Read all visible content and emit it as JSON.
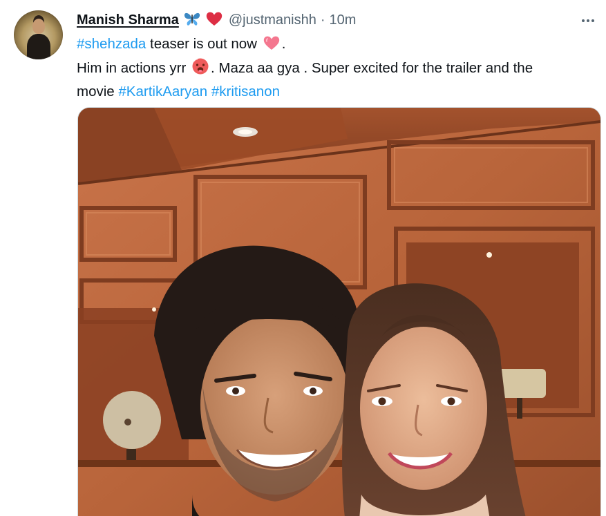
{
  "tweet": {
    "author": {
      "name": "Manish Sharma",
      "badges": [
        "butterfly-emoji",
        "red-heart-emoji"
      ],
      "handle": "@justmanishh",
      "separator": "·",
      "time": "10m"
    },
    "text": {
      "line1": {
        "hashtag": "#shehzada",
        "text": " teaser is out now ",
        "emoji": "pink-heart-emoji",
        "end": "."
      },
      "line2": {
        "text": "Him in actions yrr ",
        "emoji": "hot-face-emoji",
        "rest": ". Maza aa gya . Super excited for the trailer and the"
      },
      "line3": {
        "text": "movie ",
        "hashtag1": "#KartikAaryan",
        "space": " ",
        "hashtag2": "#kritisanon"
      }
    },
    "media": {
      "type": "photo",
      "description_icon": "selfie-photo"
    },
    "colors": {
      "hashtag": "#1d9bf0",
      "secondary_text": "#536471",
      "primary_text": "#0f1419",
      "border": "#cfd9de"
    }
  }
}
